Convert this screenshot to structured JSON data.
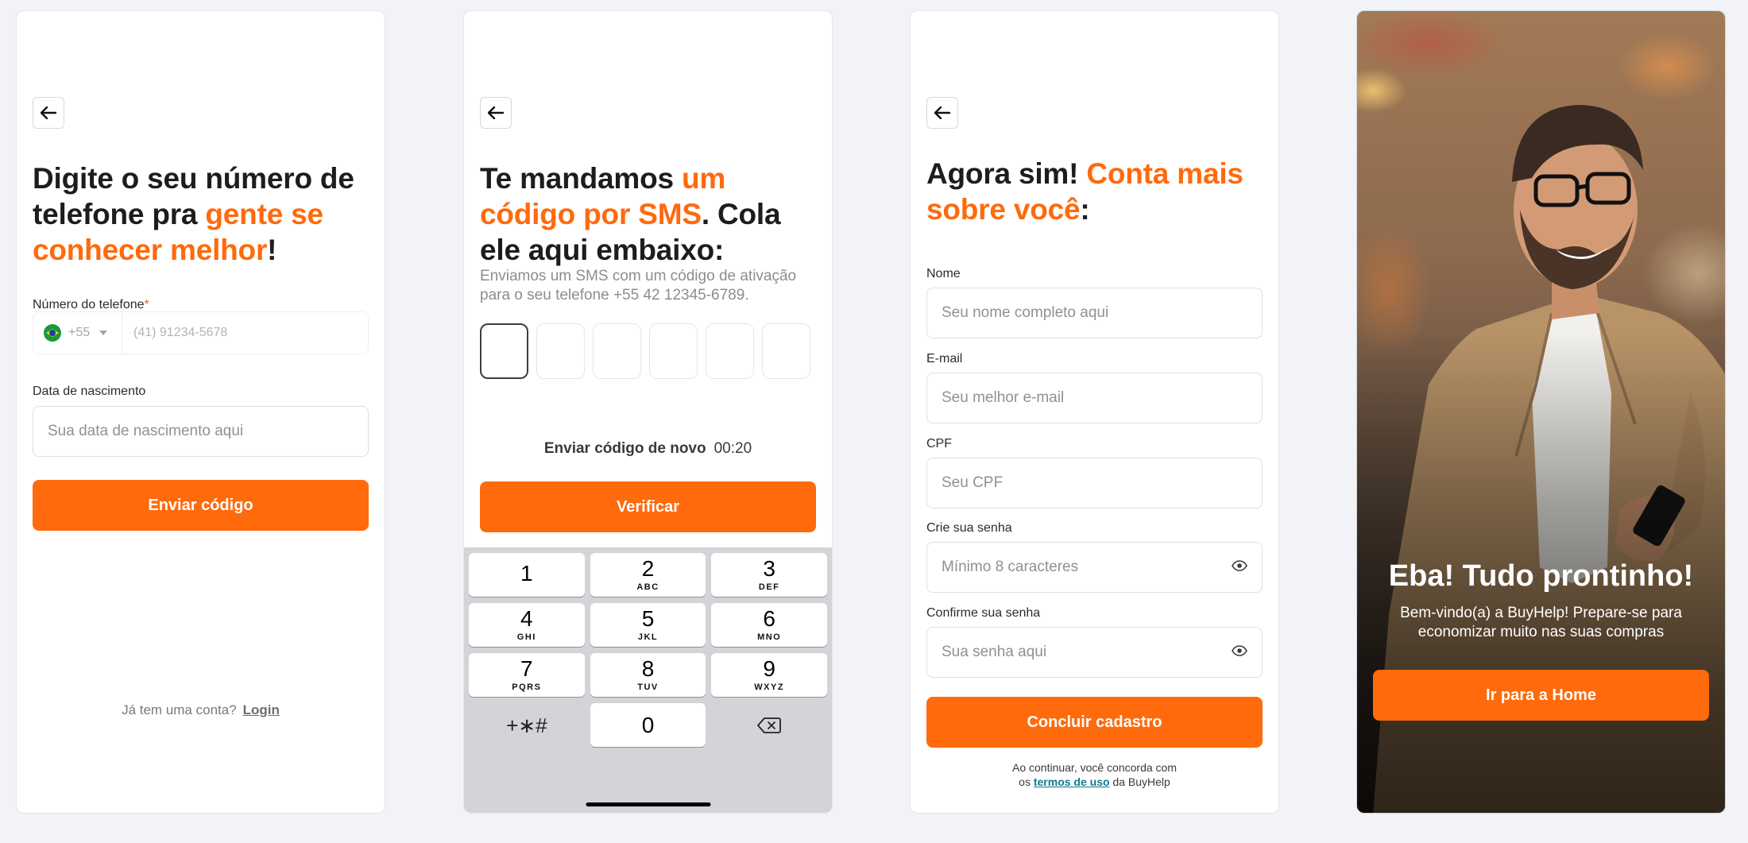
{
  "colors": {
    "accent": "#ff6a0c",
    "link": "#0f7a8f",
    "background": "#f1f3f6"
  },
  "screen_phone": {
    "heading_pre": "Digite o seu número de telefone pra ",
    "heading_highlight": "gente se conhecer melhor",
    "heading_post": "!",
    "phone_label": "Número do telefone",
    "required_mark": "*",
    "country_code": "+55",
    "phone_placeholder": "(41) 91234-5678",
    "birth_label": "Data de nascimento",
    "birth_placeholder": "Sua data de nascimento aqui",
    "submit_label": "Enviar código",
    "have_account_text": "Já tem uma conta?",
    "login_link": "Login"
  },
  "screen_sms": {
    "heading_pre": "Te mandamos ",
    "heading_highlight": "um código por SMS",
    "heading_post": ". Cola ele aqui embaixo:",
    "subtext": "Enviamos um SMS com um código de ativação para o seu telefone +55 42 12345-6789.",
    "resend_label": "Enviar código de novo",
    "timer": "00:20",
    "verify_label": "Verificar",
    "keys": [
      {
        "num": "1",
        "letters": ""
      },
      {
        "num": "2",
        "letters": "ABC"
      },
      {
        "num": "3",
        "letters": "DEF"
      },
      {
        "num": "4",
        "letters": "GHI"
      },
      {
        "num": "5",
        "letters": "JKL"
      },
      {
        "num": "6",
        "letters": "MNO"
      },
      {
        "num": "7",
        "letters": "PQRS"
      },
      {
        "num": "8",
        "letters": "TUV"
      },
      {
        "num": "9",
        "letters": "WXYZ"
      }
    ],
    "symbols_key": "+∗#",
    "zero_key": "0"
  },
  "screen_signup": {
    "heading_pre": "Agora sim! ",
    "heading_highlight": "Conta mais sobre você",
    "heading_post": ":",
    "name_label": "Nome",
    "name_placeholder": "Seu nome completo aqui",
    "email_label": "E-mail",
    "email_placeholder": "Seu melhor e-mail",
    "cpf_label": "CPF",
    "cpf_placeholder": "Seu CPF",
    "password_label": "Crie sua senha",
    "password_placeholder": "Mínimo 8 caracteres",
    "confirm_label": "Confirme sua senha",
    "confirm_placeholder": "Sua senha aqui",
    "submit_label": "Concluir cadastro",
    "terms_line1": "Ao continuar, você concorda com",
    "terms_prefix": "os",
    "terms_link": "termos de uso",
    "terms_suffix": "da BuyHelp"
  },
  "screen_done": {
    "title": "Eba! Tudo prontinho!",
    "subtitle": "Bem-vindo(a) a BuyHelp! Prepare-se para economizar muito nas suas compras",
    "home_button": "Ir para a Home"
  }
}
